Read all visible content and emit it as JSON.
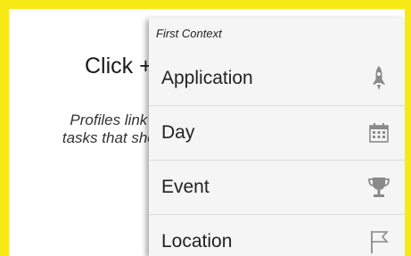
{
  "background_text": {
    "click_hint": "Click +",
    "description_line1": "Profiles link co",
    "description_line2": "tasks that shoul"
  },
  "context_menu": {
    "header": "First Context",
    "items": [
      {
        "label": "Application",
        "icon": "rocket-icon"
      },
      {
        "label": "Day",
        "icon": "calendar-icon"
      },
      {
        "label": "Event",
        "icon": "trophy-icon"
      },
      {
        "label": "Location",
        "icon": "flag-icon"
      }
    ]
  },
  "colors": {
    "frame": "#f8ea16",
    "menu_background": "#f5f5f5",
    "icon_gray": "#8a8a8a"
  }
}
